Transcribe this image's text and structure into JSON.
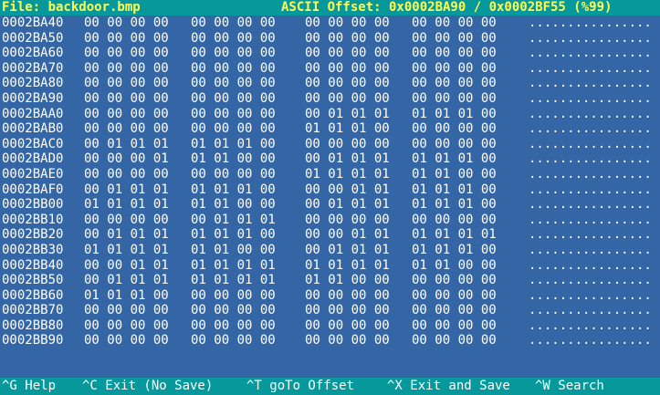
{
  "title_bar": {
    "file": "File: backdoor.bmp",
    "offset": "ASCII Offset: 0x0002BA90 / 0x0002BF55 (%99)"
  },
  "rows": [
    {
      "addr": "0002BA40",
      "g1": "00 00 00 00",
      "g2": "00 00 00 00",
      "g3": "00 00 00 00",
      "g4": "00 00 00 00",
      "ascii": "................"
    },
    {
      "addr": "0002BA50",
      "g1": "00 00 00 00",
      "g2": "00 00 00 00",
      "g3": "00 00 00 00",
      "g4": "00 00 00 00",
      "ascii": "................"
    },
    {
      "addr": "0002BA60",
      "g1": "00 00 00 00",
      "g2": "00 00 00 00",
      "g3": "00 00 00 00",
      "g4": "00 00 00 00",
      "ascii": "................"
    },
    {
      "addr": "0002BA70",
      "g1": "00 00 00 00",
      "g2": "00 00 00 00",
      "g3": "00 00 00 00",
      "g4": "00 00 00 00",
      "ascii": "................"
    },
    {
      "addr": "0002BA80",
      "g1": "00 00 00 00",
      "g2": "00 00 00 00",
      "g3": "00 00 00 00",
      "g4": "00 00 00 00",
      "ascii": "................"
    },
    {
      "addr": "0002BA90",
      "g1": "00 00 00 00",
      "g2": "00 00 00 00",
      "g3": "00 00 00 00",
      "g4": "00 00 00 00",
      "ascii": "................"
    },
    {
      "addr": "0002BAA0",
      "g1": "00 00 00 00",
      "g2": "00 00 00 00",
      "g3": "00 01 01 01",
      "g4": "01 01 01 00",
      "ascii": "................"
    },
    {
      "addr": "0002BAB0",
      "g1": "00 00 00 00",
      "g2": "00 00 00 00",
      "g3": "01 01 01 00",
      "g4": "00 00 00 00",
      "ascii": "................"
    },
    {
      "addr": "0002BAC0",
      "g1": "00 01 01 01",
      "g2": "01 01 01 00",
      "g3": "00 00 00 00",
      "g4": "00 00 00 00",
      "ascii": "................"
    },
    {
      "addr": "0002BAD0",
      "g1": "00 00 00 01",
      "g2": "01 01 00 00",
      "g3": "00 01 01 01",
      "g4": "01 01 01 00",
      "ascii": "................"
    },
    {
      "addr": "0002BAE0",
      "g1": "00 00 00 00",
      "g2": "00 00 00 00",
      "g3": "01 01 01 01",
      "g4": "01 01 00 00",
      "ascii": "................"
    },
    {
      "addr": "0002BAF0",
      "g1": "00 01 01 01",
      "g2": "01 01 01 00",
      "g3": "00 00 01 01",
      "g4": "01 01 01 00",
      "ascii": "................"
    },
    {
      "addr": "0002BB00",
      "g1": "01 01 01 01",
      "g2": "01 01 00 00",
      "g3": "00 01 01 01",
      "g4": "01 01 01 00",
      "ascii": "................"
    },
    {
      "addr": "0002BB10",
      "g1": "00 00 00 00",
      "g2": "00 01 01 01",
      "g3": "00 00 00 00",
      "g4": "00 00 00 00",
      "ascii": "................"
    },
    {
      "addr": "0002BB20",
      "g1": "00 01 01 01",
      "g2": "01 01 01 00",
      "g3": "00 00 01 01",
      "g4": "01 01 01 01",
      "ascii": "................"
    },
    {
      "addr": "0002BB30",
      "g1": "01 01 01 01",
      "g2": "01 01 00 00",
      "g3": "00 01 01 01",
      "g4": "01 01 01 00",
      "ascii": "................"
    },
    {
      "addr": "0002BB40",
      "g1": "00 00 01 01",
      "g2": "01 01 01 01",
      "g3": "01 01 01 01",
      "g4": "01 01 00 00",
      "ascii": "................"
    },
    {
      "addr": "0002BB50",
      "g1": "00 01 01 01",
      "g2": "01 01 01 01",
      "g3": "01 01 00 00",
      "g4": "00 00 00 00",
      "ascii": "................"
    },
    {
      "addr": "0002BB60",
      "g1": "01 01 01 00",
      "g2": "00 00 00 00",
      "g3": "00 00 00 00",
      "g4": "00 00 00 00",
      "ascii": "................"
    },
    {
      "addr": "0002BB70",
      "g1": "00 00 00 00",
      "g2": "00 00 00 00",
      "g3": "00 00 00 00",
      "g4": "00 00 00 00",
      "ascii": "................"
    },
    {
      "addr": "0002BB80",
      "g1": "00 00 00 00",
      "g2": "00 00 00 00",
      "g3": "00 00 00 00",
      "g4": "00 00 00 00",
      "ascii": "................"
    },
    {
      "addr": "0002BB90",
      "g1": "00 00 00 00",
      "g2": "00 00 00 00",
      "g3": "00 00 00 00",
      "g4": "00 00 00 00",
      "ascii": "................"
    }
  ],
  "footer": {
    "help": "^G Help",
    "exit_no_save": "^C Exit (No Save)",
    "goto_offset": "^T goTo Offset",
    "exit_save": "^X Exit and Save",
    "search": "^W Search"
  },
  "colors": {
    "background": "#3465a4",
    "bar": "#06989a",
    "title_text": "#ffff54",
    "text": "#ffffff"
  }
}
